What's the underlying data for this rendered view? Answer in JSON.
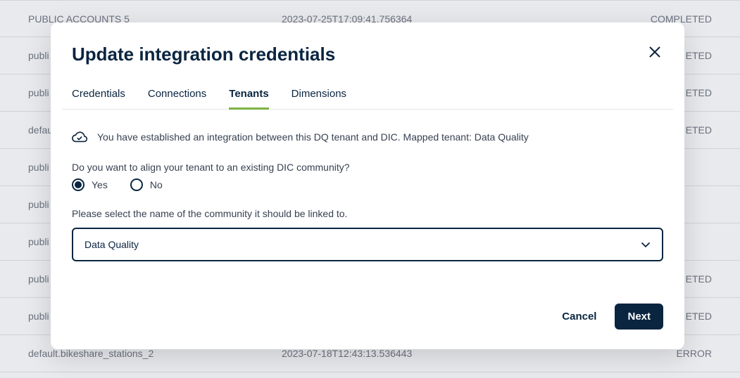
{
  "background": {
    "rows": [
      {
        "name": "PUBLIC ACCOUNTS 5",
        "date": "2023-07-25T17:09:41.756364",
        "status": "COMPLETED"
      },
      {
        "name": "publi",
        "date": "",
        "status": "ETED"
      },
      {
        "name": "publi",
        "date": "",
        "status": "ETED"
      },
      {
        "name": "defau",
        "date": "",
        "status": "ETED"
      },
      {
        "name": "publi",
        "date": "",
        "status": ""
      },
      {
        "name": "publi",
        "date": "",
        "status": ""
      },
      {
        "name": "publi",
        "date": "",
        "status": ""
      },
      {
        "name": "publi",
        "date": "",
        "status": "ETED"
      },
      {
        "name": "publi",
        "date": "",
        "status": "ETED"
      },
      {
        "name": "default.bikeshare_stations_2",
        "date": "2023-07-18T12:43:13.536443",
        "status": "ERROR"
      }
    ]
  },
  "modal": {
    "title": "Update integration credentials",
    "tabs": [
      "Credentials",
      "Connections",
      "Tenants",
      "Dimensions"
    ],
    "activeTabIndex": 2,
    "infoText": "You have established an integration between this DQ tenant and DIC. Mapped tenant: Data Quality",
    "questionText": "Do you want to align your tenant to an existing DIC community?",
    "radioYes": "Yes",
    "radioNo": "No",
    "selectLabel": "Please select the name of the community it should be linked to.",
    "selectedCommunity": "Data Quality",
    "cancelLabel": "Cancel",
    "nextLabel": "Next"
  }
}
